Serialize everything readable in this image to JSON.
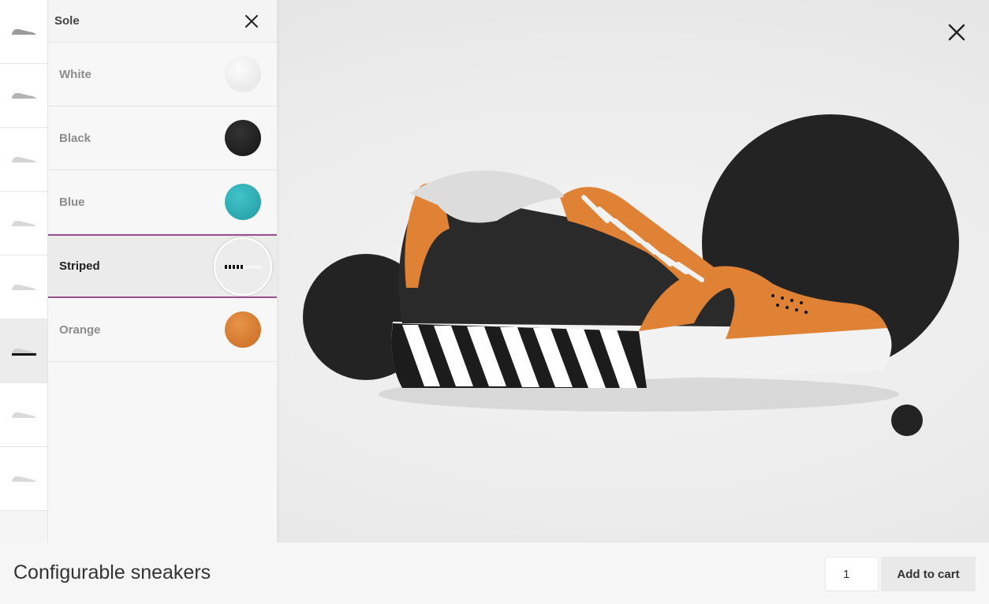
{
  "panel": {
    "title": "Sole",
    "options": [
      {
        "label": "White",
        "color": "#efefef"
      },
      {
        "label": "Black",
        "color": "#1f1f1f"
      },
      {
        "label": "Blue",
        "color": "#2fb4bc"
      },
      {
        "label": "Striped",
        "color": "#e6e6e6"
      },
      {
        "label": "Orange",
        "color": "#d9782c"
      }
    ],
    "selected": "Striped"
  },
  "thumbnails": {
    "count": 8,
    "active_index": 5
  },
  "product": {
    "title": "Configurable sneakers",
    "upper_color": "#e08236",
    "body_color": "#2a2a2a"
  },
  "cart": {
    "quantity": "1",
    "add_label": "Add to cart"
  },
  "icons": {
    "panel_close": "close-icon",
    "stage_close": "close-icon"
  }
}
